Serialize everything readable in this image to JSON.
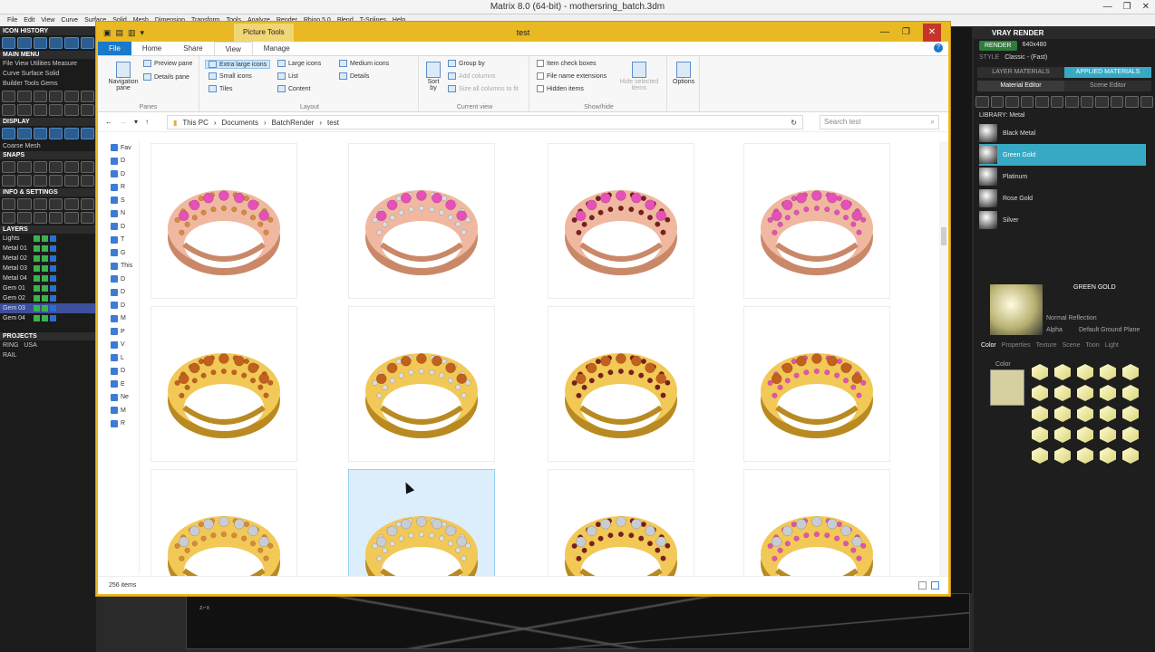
{
  "host": {
    "title": "Matrix 8.0 (64-bit) - mothersring_batch.3dm",
    "menu": [
      "File",
      "Edit",
      "View",
      "Curve",
      "Surface",
      "Solid",
      "Mesh",
      "Dimension",
      "Transform",
      "Tools",
      "Analyze",
      "Render",
      "Rhino 5.0",
      "Blend",
      "T-Splines",
      "Help"
    ],
    "win_buttons": [
      "—",
      "❐",
      "✕"
    ]
  },
  "left_panel": {
    "icon_history": "ICON HISTORY",
    "main_menu": "MAIN MENU",
    "menu_lines": [
      "File  View  Utilities  Measure",
      "Curve  Surface  Solid",
      "Builder  Tools  Gems"
    ],
    "display": "DISPLAY",
    "coarse": "Coarse Mesh",
    "snaps": "SNAPS",
    "info": "INFO & SETTINGS",
    "layers_head": "LAYERS",
    "layers": [
      "Lights",
      "Metal 01",
      "Metal 02",
      "Metal 03",
      "Metal 04",
      "Gem 01",
      "Gem 02",
      "Gem 03",
      "Gem 04"
    ],
    "projects": "PROJECTS",
    "ring": "RING",
    "rail": "RAIL",
    "usa": "USA"
  },
  "right_panel": {
    "title": "VRAY RENDER",
    "render_btn": "RENDER",
    "resolution": "640x480",
    "style_label": "STYLE",
    "style_value": "Classic - (Fast)",
    "tabs": [
      "LAYER MATERIALS",
      "APPLIED MATERIALS"
    ],
    "sub_tabs": [
      "Material Editor",
      "Scene Editor"
    ],
    "library": "LIBRARY: Metal",
    "materials": [
      "Black Metal",
      "Green Gold",
      "Platinum",
      "Rose Gold",
      "Silver"
    ],
    "selected_material": "GREEN GOLD",
    "reflection": "Normal Reflection",
    "alpha": "Alpha",
    "ground": "Default Ground Plane",
    "bottom_tabs": [
      "Color",
      "Properties",
      "Texture",
      "Scene",
      "Toon",
      "Light"
    ],
    "color_label": "Color"
  },
  "explorer": {
    "title": "test",
    "picture_tools": "Picture Tools",
    "tabs": [
      "File",
      "Home",
      "Share",
      "View",
      "Manage"
    ],
    "panes": {
      "preview": "Preview pane",
      "details": "Details pane",
      "nav": "Navigation pane",
      "label": "Panes"
    },
    "layout": {
      "items": [
        "Extra large icons",
        "Large icons",
        "Medium icons",
        "Small icons",
        "List",
        "Details",
        "Tiles",
        "Content"
      ],
      "label": "Layout"
    },
    "current_view": {
      "sort": "Sort by",
      "group": "Group by",
      "add_columns": "Add columns",
      "size_cols": "Size all columns to fit",
      "label": "Current view"
    },
    "show_hide": {
      "item_check": "Item check boxes",
      "file_ext": "File name extensions",
      "hidden": "Hidden items",
      "hide_selected": "Hide selected items",
      "label": "Show/hide"
    },
    "options": "Options",
    "breadcrumb": [
      "This PC",
      "Documents",
      "BatchRender",
      "test"
    ],
    "search_placeholder": "Search test",
    "nav_items": [
      "Fav",
      "D",
      "D",
      "R",
      "S",
      "N",
      "D",
      "T",
      "G",
      "This",
      "D",
      "D",
      "D",
      "M",
      "P",
      "V",
      "L",
      "D",
      "E",
      "Ne",
      "M",
      "R"
    ],
    "status": "256 items"
  },
  "rings": [
    {
      "band": "#f0b8a0",
      "band_dark": "#c98868",
      "row1": "#d88a3a",
      "row2": "#e650b8",
      "row3": "#d88a3a"
    },
    {
      "band": "#f0b8a0",
      "band_dark": "#c98868",
      "row1": "#d8dde6",
      "row2": "#e650b8",
      "row3": "#d8dde6"
    },
    {
      "band": "#f0b8a0",
      "band_dark": "#c98868",
      "row1": "#7a1e20",
      "row2": "#e650b8",
      "row3": "#7a1e20"
    },
    {
      "band": "#f0b8a0",
      "band_dark": "#c98868",
      "row1": "#e650b8",
      "row2": "#e650b8",
      "row3": "#e650b8"
    },
    {
      "band": "#f2c857",
      "band_dark": "#b98a22",
      "row1": "#c2601e",
      "row2": "#c2601e",
      "row3": "#c2601e"
    },
    {
      "band": "#f2c857",
      "band_dark": "#b98a22",
      "row1": "#d8dde6",
      "row2": "#c2601e",
      "row3": "#d8dde6"
    },
    {
      "band": "#f2c857",
      "band_dark": "#b98a22",
      "row1": "#7a1e20",
      "row2": "#c2601e",
      "row3": "#7a1e20"
    },
    {
      "band": "#f2c857",
      "band_dark": "#b98a22",
      "row1": "#e650b8",
      "row2": "#c2601e",
      "row3": "#e650b8"
    },
    {
      "band": "#f2c857",
      "band_dark": "#b98a22",
      "row1": "#d88a3a",
      "row2": "#c8ccd6",
      "row3": "#d88a3a"
    },
    {
      "band": "#f2c857",
      "band_dark": "#b98a22",
      "row1": "#d8dde6",
      "row2": "#c8ccd6",
      "row3": "#d8dde6"
    },
    {
      "band": "#f2c857",
      "band_dark": "#b98a22",
      "row1": "#7a1e20",
      "row2": "#c8ccd6",
      "row3": "#7a1e20"
    },
    {
      "band": "#f2c857",
      "band_dark": "#b98a22",
      "row1": "#e650b8",
      "row2": "#c8ccd6",
      "row3": "#e650b8"
    }
  ],
  "selected_tile": 9
}
